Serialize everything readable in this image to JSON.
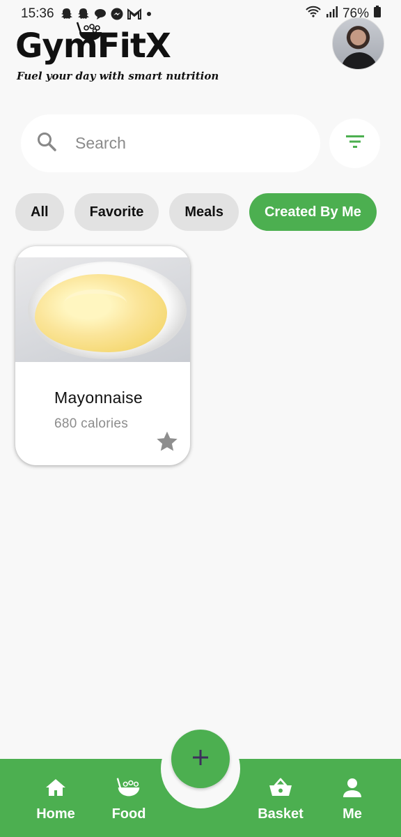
{
  "status_bar": {
    "time": "15:36",
    "battery": "76%",
    "notification_icons": [
      "snapchat-icon",
      "snapchat-icon",
      "chat-bubble-icon",
      "messenger-icon",
      "gmail-icon",
      "dot-icon"
    ]
  },
  "header": {
    "app_name": "GymFitX",
    "tagline": "Fuel your day with smart nutrition"
  },
  "search": {
    "placeholder": "Search"
  },
  "filter_chips": [
    {
      "label": "All",
      "active": false
    },
    {
      "label": "Favorite",
      "active": false
    },
    {
      "label": "Meals",
      "active": false
    },
    {
      "label": "Created By Me",
      "active": true
    }
  ],
  "food_items": [
    {
      "name": "Mayonnaise",
      "calories": "680 calories",
      "favorite": false
    }
  ],
  "bottom_nav": {
    "items": [
      {
        "label": "Home",
        "icon": "home-icon"
      },
      {
        "label": "Food",
        "icon": "food-bowl-icon"
      },
      {
        "label": "Basket",
        "icon": "basket-icon"
      },
      {
        "label": "Me",
        "icon": "person-icon"
      }
    ],
    "fab_icon": "plus-icon"
  },
  "colors": {
    "accent": "#4caf50",
    "background": "#f8f8f8",
    "chip_inactive": "#e2e2e2",
    "fab_plus": "#3d2e5c"
  }
}
